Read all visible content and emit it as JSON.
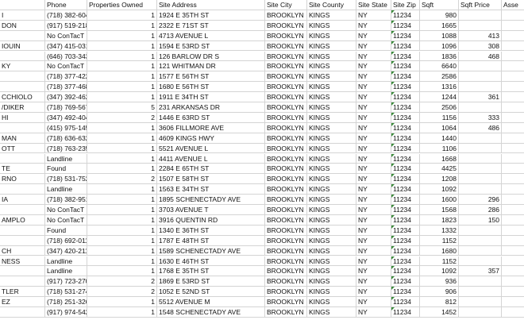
{
  "headers": {
    "name": "",
    "phone": "Phone",
    "props": "Properties Owned",
    "addr": "Site Address",
    "city": "Site City",
    "county": "Site County",
    "state": "Site State",
    "zip": "Site Zip",
    "sqft": "Sqft",
    "sqft_price": "Sqft Price",
    "asse": "Asse"
  },
  "rows": [
    {
      "name": "I",
      "phone": "(718) 382-6049",
      "props": "1",
      "addr": "1924 E 35TH ST",
      "city": "BROOKLYN",
      "county": "KINGS",
      "state": "NY",
      "zip": "11234",
      "sqft": "980",
      "sqft_price": ""
    },
    {
      "name": "DON",
      "phone": "(917) 519-2189",
      "props": "1",
      "addr": "2322 E 71ST ST",
      "city": "BROOKLYN",
      "county": "KINGS",
      "state": "NY",
      "zip": "11234",
      "sqft": "1665",
      "sqft_price": ""
    },
    {
      "name": "",
      "phone": "No ConTacT Four",
      "props": "1",
      "addr": "4713 AVENUE L",
      "city": "BROOKLYN",
      "county": "KINGS",
      "state": "NY",
      "zip": "11234",
      "sqft": "1088",
      "sqft_price": "413"
    },
    {
      "name": "IOUIN",
      "phone": "(347) 415-0319",
      "props": "1",
      "addr": "1594 E 53RD ST",
      "city": "BROOKLYN",
      "county": "KINGS",
      "state": "NY",
      "zip": "11234",
      "sqft": "1096",
      "sqft_price": "308"
    },
    {
      "name": "",
      "phone": "(646) 703-3435",
      "props": "1",
      "addr": "126 BARLOW DR S",
      "city": "BROOKLYN",
      "county": "KINGS",
      "state": "NY",
      "zip": "11234",
      "sqft": "1836",
      "sqft_price": "468"
    },
    {
      "name": "KY",
      "phone": "No ConTacT Four",
      "props": "1",
      "addr": "121 WHITMAN DR",
      "city": "BROOKLYN",
      "county": "KINGS",
      "state": "NY",
      "zip": "11234",
      "sqft": "6640",
      "sqft_price": ""
    },
    {
      "name": "",
      "phone": "(718) 377-4220",
      "props": "1",
      "addr": "1577 E 56TH ST",
      "city": "BROOKLYN",
      "county": "KINGS",
      "state": "NY",
      "zip": "11234",
      "sqft": "2586",
      "sqft_price": ""
    },
    {
      "name": "",
      "phone": "(718) 377-4686",
      "props": "1",
      "addr": "1680 E 56TH ST",
      "city": "BROOKLYN",
      "county": "KINGS",
      "state": "NY",
      "zip": "11234",
      "sqft": "1316",
      "sqft_price": ""
    },
    {
      "name": "CCHIOLO",
      "phone": "(347) 392-4620",
      "props": "1",
      "addr": "1911 E 34TH ST",
      "city": "BROOKLYN",
      "county": "KINGS",
      "state": "NY",
      "zip": "11234",
      "sqft": "1244",
      "sqft_price": "361"
    },
    {
      "name": "/DIKER",
      "phone": "(718) 769-5675",
      "props": "5",
      "addr": "231 ARKANSAS DR",
      "city": "BROOKLYN",
      "county": "KINGS",
      "state": "NY",
      "zip": "11234",
      "sqft": "2506",
      "sqft_price": ""
    },
    {
      "name": "HI",
      "phone": "(347) 492-4041",
      "props": "2",
      "addr": "1446 E 63RD ST",
      "city": "BROOKLYN",
      "county": "KINGS",
      "state": "NY",
      "zip": "11234",
      "sqft": "1156",
      "sqft_price": "333"
    },
    {
      "name": "",
      "phone": "(415) 975-1457",
      "props": "1",
      "addr": "3606 FILLMORE AVE",
      "city": "BROOKLYN",
      "county": "KINGS",
      "state": "NY",
      "zip": "11234",
      "sqft": "1064",
      "sqft_price": "486"
    },
    {
      "name": "MAN",
      "phone": "(718) 636-6325",
      "props": "1",
      "addr": "4609 KINGS HWY",
      "city": "BROOKLYN",
      "county": "KINGS",
      "state": "NY",
      "zip": "11234",
      "sqft": "1440",
      "sqft_price": ""
    },
    {
      "name": "OTT",
      "phone": "(718) 763-2353",
      "props": "1",
      "addr": "5521 AVENUE L",
      "city": "BROOKLYN",
      "county": "KINGS",
      "state": "NY",
      "zip": "11234",
      "sqft": "1106",
      "sqft_price": ""
    },
    {
      "name": "",
      "phone": "Landline",
      "props": "1",
      "addr": "4411 AVENUE L",
      "city": "BROOKLYN",
      "county": "KINGS",
      "state": "NY",
      "zip": "11234",
      "sqft": "1668",
      "sqft_price": ""
    },
    {
      "name": "TE",
      "phone": "Found",
      "props": "1",
      "addr": "2284 E 65TH ST",
      "city": "BROOKLYN",
      "county": "KINGS",
      "state": "NY",
      "zip": "11234",
      "sqft": "4425",
      "sqft_price": ""
    },
    {
      "name": "RNO",
      "phone": "(718) 531-7527 -",
      "props": "2",
      "addr": "1507 E 58TH ST",
      "city": "BROOKLYN",
      "county": "KINGS",
      "state": "NY",
      "zip": "11234",
      "sqft": "1208",
      "sqft_price": ""
    },
    {
      "name": "",
      "phone": "Landline",
      "props": "1",
      "addr": "1563 E 34TH ST",
      "city": "BROOKLYN",
      "county": "KINGS",
      "state": "NY",
      "zip": "11234",
      "sqft": "1092",
      "sqft_price": ""
    },
    {
      "name": "IA",
      "phone": "(718) 382-9512 -",
      "props": "1",
      "addr": "1895 SCHENECTADY AVE",
      "city": "BROOKLYN",
      "county": "KINGS",
      "state": "NY",
      "zip": "11234",
      "sqft": "1600",
      "sqft_price": "296"
    },
    {
      "name": "",
      "phone": "No ConTacT",
      "props": "1",
      "addr": "3703 AVENUE T",
      "city": "BROOKLYN",
      "county": "KINGS",
      "state": "NY",
      "zip": "11234",
      "sqft": "1568",
      "sqft_price": "286"
    },
    {
      "name": "AMPLO",
      "phone": "No ConTacT",
      "props": "1",
      "addr": "3916 QUENTIN RD",
      "city": "BROOKLYN",
      "county": "KINGS",
      "state": "NY",
      "zip": "11234",
      "sqft": "1823",
      "sqft_price": "150"
    },
    {
      "name": "",
      "phone": "Found",
      "props": "1",
      "addr": "1340 E 36TH ST",
      "city": "BROOKLYN",
      "county": "KINGS",
      "state": "NY",
      "zip": "11234",
      "sqft": "1332",
      "sqft_price": ""
    },
    {
      "name": "",
      "phone": "(718) 692-0116 -",
      "props": "1",
      "addr": "1787 E 48TH ST",
      "city": "BROOKLYN",
      "county": "KINGS",
      "state": "NY",
      "zip": "11234",
      "sqft": "1152",
      "sqft_price": ""
    },
    {
      "name": "CH",
      "phone": "(347) 420-2116 -",
      "props": "1",
      "addr": "1589 SCHENECTADY AVE",
      "city": "BROOKLYN",
      "county": "KINGS",
      "state": "NY",
      "zip": "11234",
      "sqft": "1680",
      "sqft_price": ""
    },
    {
      "name": "NESS",
      "phone": "Landline",
      "props": "1",
      "addr": "1630 E 46TH ST",
      "city": "BROOKLYN",
      "county": "KINGS",
      "state": "NY",
      "zip": "11234",
      "sqft": "1152",
      "sqft_price": ""
    },
    {
      "name": "",
      "phone": "Landline",
      "props": "1",
      "addr": "1768 E 35TH ST",
      "city": "BROOKLYN",
      "county": "KINGS",
      "state": "NY",
      "zip": "11234",
      "sqft": "1092",
      "sqft_price": "357"
    },
    {
      "name": "",
      "phone": "(917) 723-2700 -",
      "props": "2",
      "addr": "1869 E 53RD ST",
      "city": "BROOKLYN",
      "county": "KINGS",
      "state": "NY",
      "zip": "11234",
      "sqft": "936",
      "sqft_price": ""
    },
    {
      "name": "TLER",
      "phone": "(718) 531-2743 -",
      "props": "2",
      "addr": "1052 E 52ND ST",
      "city": "BROOKLYN",
      "county": "KINGS",
      "state": "NY",
      "zip": "11234",
      "sqft": "906",
      "sqft_price": ""
    },
    {
      "name": "EZ",
      "phone": "(718) 251-3260 -",
      "props": "1",
      "addr": "5512 AVENUE M",
      "city": "BROOKLYN",
      "county": "KINGS",
      "state": "NY",
      "zip": "11234",
      "sqft": "812",
      "sqft_price": ""
    },
    {
      "name": "",
      "phone": "(917) 974-5422 -",
      "props": "1",
      "addr": "1548 SCHENECTADY AVE",
      "city": "BROOKLYN",
      "county": "KINGS",
      "state": "NY",
      "zip": "11234",
      "sqft": "1452",
      "sqft_price": ""
    }
  ]
}
